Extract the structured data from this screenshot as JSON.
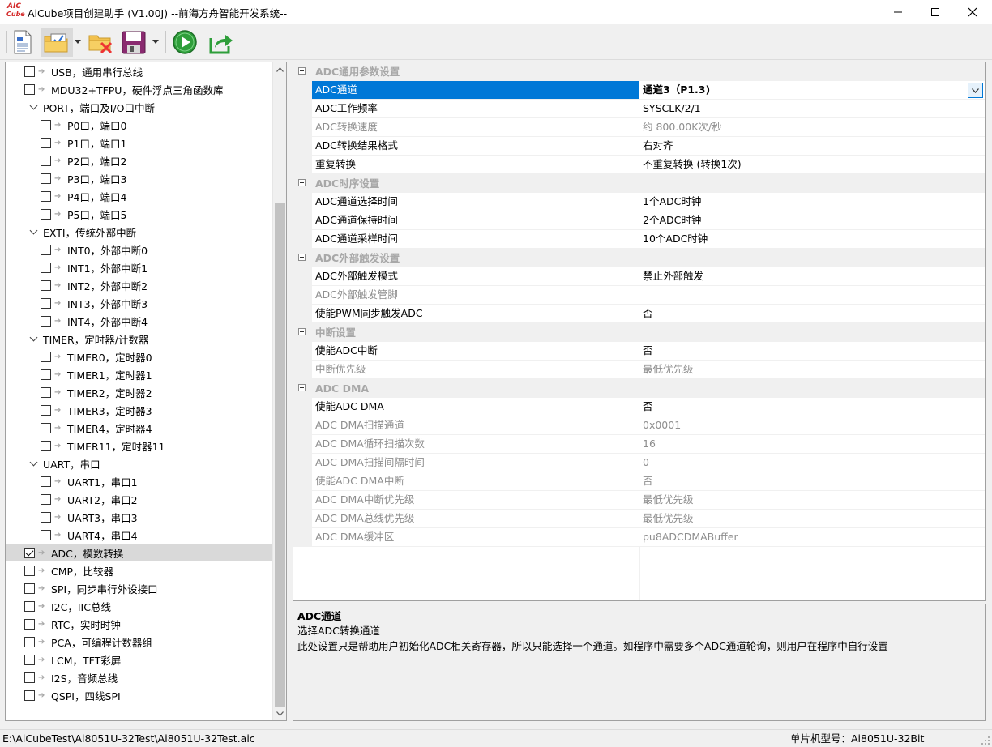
{
  "window": {
    "logo_top": "AIC",
    "logo_bottom": "Cube",
    "title": "AiCube项目创建助手 (V1.00J) --前海方舟智能开发系统--",
    "controls": [
      "minimize",
      "maximize",
      "close"
    ]
  },
  "toolbar": {
    "buttons": [
      "new-document-icon",
      "open-checklist-folder-icon",
      "close-folder-icon",
      "save-icon",
      "run-icon",
      "export-icon"
    ]
  },
  "tree": {
    "items": [
      {
        "label": "USB，通用串行总线",
        "checked": false,
        "level": 1
      },
      {
        "label": "MDU32+TFPU，硬件浮点三角函数库",
        "checked": false,
        "level": 1
      },
      {
        "label": "PORT，端口及I/O口中断",
        "group": true
      },
      {
        "label": "P0口，端口0",
        "checked": false,
        "level": 2
      },
      {
        "label": "P1口，端口1",
        "checked": false,
        "level": 2
      },
      {
        "label": "P2口，端口2",
        "checked": false,
        "level": 2
      },
      {
        "label": "P3口，端口3",
        "checked": false,
        "level": 2
      },
      {
        "label": "P4口，端口4",
        "checked": false,
        "level": 2
      },
      {
        "label": "P5口，端口5",
        "checked": false,
        "level": 2
      },
      {
        "label": "EXTI，传统外部中断",
        "group": true
      },
      {
        "label": "INT0，外部中断0",
        "checked": false,
        "level": 2
      },
      {
        "label": "INT1，外部中断1",
        "checked": false,
        "level": 2
      },
      {
        "label": "INT2，外部中断2",
        "checked": false,
        "level": 2
      },
      {
        "label": "INT3，外部中断3",
        "checked": false,
        "level": 2
      },
      {
        "label": "INT4，外部中断4",
        "checked": false,
        "level": 2
      },
      {
        "label": "TIMER，定时器/计数器",
        "group": true
      },
      {
        "label": "TIMER0，定时器0",
        "checked": false,
        "level": 2
      },
      {
        "label": "TIMER1，定时器1",
        "checked": false,
        "level": 2
      },
      {
        "label": "TIMER2，定时器2",
        "checked": false,
        "level": 2
      },
      {
        "label": "TIMER3，定时器3",
        "checked": false,
        "level": 2
      },
      {
        "label": "TIMER4，定时器4",
        "checked": false,
        "level": 2
      },
      {
        "label": "TIMER11，定时器11",
        "checked": false,
        "level": 2
      },
      {
        "label": "UART，串口",
        "group": true
      },
      {
        "label": "UART1，串口1",
        "checked": false,
        "level": 2
      },
      {
        "label": "UART2，串口2",
        "checked": false,
        "level": 2
      },
      {
        "label": "UART3，串口3",
        "checked": false,
        "level": 2
      },
      {
        "label": "UART4，串口4",
        "checked": false,
        "level": 2
      },
      {
        "label": "ADC，模数转换",
        "checked": true,
        "level": 1,
        "selected": true
      },
      {
        "label": "CMP，比较器",
        "checked": false,
        "level": 1
      },
      {
        "label": "SPI，同步串行外设接口",
        "checked": false,
        "level": 1
      },
      {
        "label": "I2C，IIC总线",
        "checked": false,
        "level": 1
      },
      {
        "label": "RTC，实时时钟",
        "checked": false,
        "level": 1
      },
      {
        "label": "PCA，可编程计数器组",
        "checked": false,
        "level": 1
      },
      {
        "label": "LCM，TFT彩屏",
        "checked": false,
        "level": 1
      },
      {
        "label": "I2S，音频总线",
        "checked": false,
        "level": 1
      },
      {
        "label": "QSPI，四线SPI",
        "checked": false,
        "level": 1
      }
    ]
  },
  "properties": {
    "rows": [
      {
        "category": "ADC通用参数设置"
      },
      {
        "name": "ADC通道",
        "value": "通道3（P1.3)",
        "selected": true,
        "bold": true,
        "dropdown": true
      },
      {
        "name": "ADC工作频率",
        "value": "SYSCLK/2/1"
      },
      {
        "name": "ADC转换速度",
        "value": "约 800.00K次/秒",
        "disabled": true
      },
      {
        "name": "ADC转换结果格式",
        "value": "右对齐"
      },
      {
        "name": "重复转换",
        "value": "不重复转换 (转换1次)"
      },
      {
        "category": "ADC时序设置"
      },
      {
        "name": "ADC通道选择时间",
        "value": " 1个ADC时钟"
      },
      {
        "name": "ADC通道保持时间",
        "value": " 2个ADC时钟"
      },
      {
        "name": "ADC通道采样时间",
        "value": "10个ADC时钟"
      },
      {
        "category": "ADC外部触发设置"
      },
      {
        "name": "ADC外部触发模式",
        "value": "禁止外部触发"
      },
      {
        "name": "ADC外部触发管脚",
        "value": "",
        "disabled": true
      },
      {
        "name": "使能PWM同步触发ADC",
        "value": "否"
      },
      {
        "category": "中断设置"
      },
      {
        "name": "使能ADC中断",
        "value": "否"
      },
      {
        "name": "中断优先级",
        "value": "最低优先级",
        "disabled": true
      },
      {
        "category": "ADC DMA"
      },
      {
        "name": "使能ADC DMA",
        "value": "否"
      },
      {
        "name": "ADC DMA扫描通道",
        "value": "0x0001",
        "disabled": true
      },
      {
        "name": "ADC DMA循环扫描次数",
        "value": "16",
        "disabled": true
      },
      {
        "name": "ADC DMA扫描间隔时间",
        "value": "0",
        "disabled": true
      },
      {
        "name": "使能ADC DMA中断",
        "value": "否",
        "disabled": true
      },
      {
        "name": "ADC DMA中断优先级",
        "value": "最低优先级",
        "disabled": true
      },
      {
        "name": "ADC DMA总线优先级",
        "value": "最低优先级",
        "disabled": true
      },
      {
        "name": "ADC DMA缓冲区",
        "value": "pu8ADCDMABuffer",
        "disabled": true
      }
    ]
  },
  "description": {
    "title": "ADC通道",
    "line1": "选择ADC转换通道",
    "line2": "此处设置只是帮助用户初始化ADC相关寄存器，所以只能选择一个通道。如程序中需要多个ADC通道轮询，则用户在程序中自行设置"
  },
  "status": {
    "path": "E:\\AiCubeTest\\Ai8051U-32Test\\Ai8051U-32Test.aic",
    "chip": "单片机型号：Ai8051U-32Bit"
  },
  "colors": {
    "selection": "#0078d7",
    "category_text": "#a8a8a8",
    "disabled_text": "#8e8e8e",
    "run_green": "#2e9e3a",
    "logo_red": "#d42a2a"
  }
}
